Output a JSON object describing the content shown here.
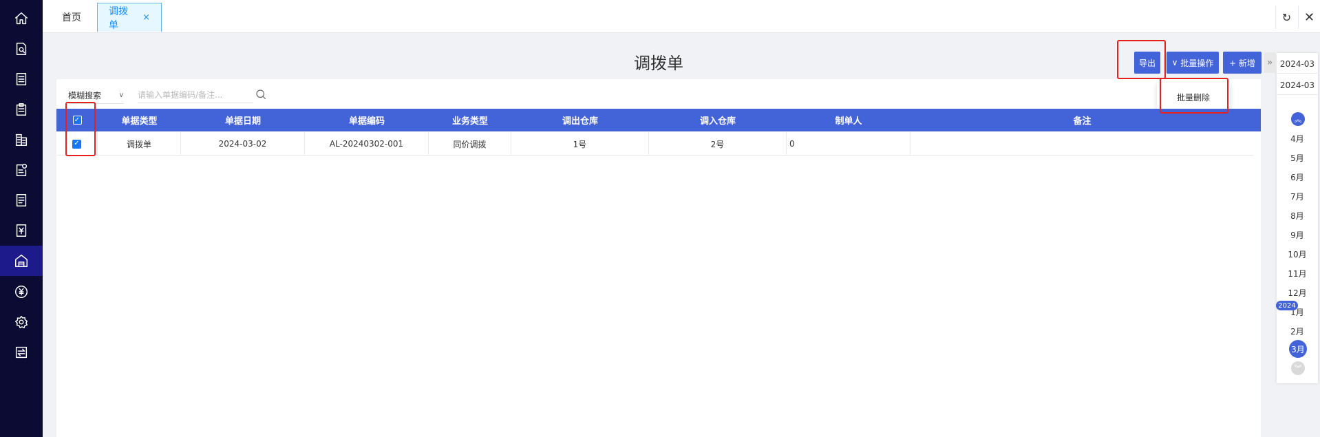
{
  "tabs": {
    "home_label": "首页",
    "active_label": "调拨单",
    "close_symbol": "×",
    "refresh_icon": "↻",
    "close_all_icon": "✕"
  },
  "page_title": "调拨单",
  "toolbar": {
    "export_label": "导出",
    "batch_label": "批量操作",
    "batch_arrow": "∨",
    "add_label": "+ 新增",
    "collapse_arrow": "»"
  },
  "dropdown": {
    "items": [
      "批量删除"
    ]
  },
  "search": {
    "mode_label": "模糊搜索",
    "mode_chevron": "∨",
    "placeholder": "请输入单据编码/备注..."
  },
  "table": {
    "headers": [
      "单据类型",
      "单据日期",
      "单据编码",
      "业务类型",
      "调出仓库",
      "调入仓库",
      "制单人",
      "备注"
    ],
    "rows": [
      [
        "调拨单",
        "2024-03-02",
        "AL-20240302-001",
        "同价调拨",
        "1号",
        "2号",
        "0",
        ""
      ]
    ]
  },
  "date_panel": {
    "start_date": "2024-03",
    "end_date": "2024-03",
    "months": [
      "4月",
      "5月",
      "6月",
      "7月",
      "8月",
      "9月",
      "10月",
      "11月",
      "12月",
      "1月",
      "2月"
    ],
    "current_month": "3月",
    "year_badge": "2024",
    "up_icon": "︽",
    "down_icon": "︾"
  },
  "colors": {
    "sidebar_bg": "#0b0b33",
    "primary": "#4363d8",
    "tab_active": "#1890ff",
    "highlight": "#e8201c"
  },
  "sidebar_icons": [
    "home-icon",
    "document-search-icon",
    "list-icon",
    "clipboard-icon",
    "building-icon",
    "document-settings-icon",
    "receipt-icon",
    "yen-document-icon",
    "warehouse-icon",
    "yen-circle-icon",
    "gear-icon",
    "transfer-icon"
  ]
}
